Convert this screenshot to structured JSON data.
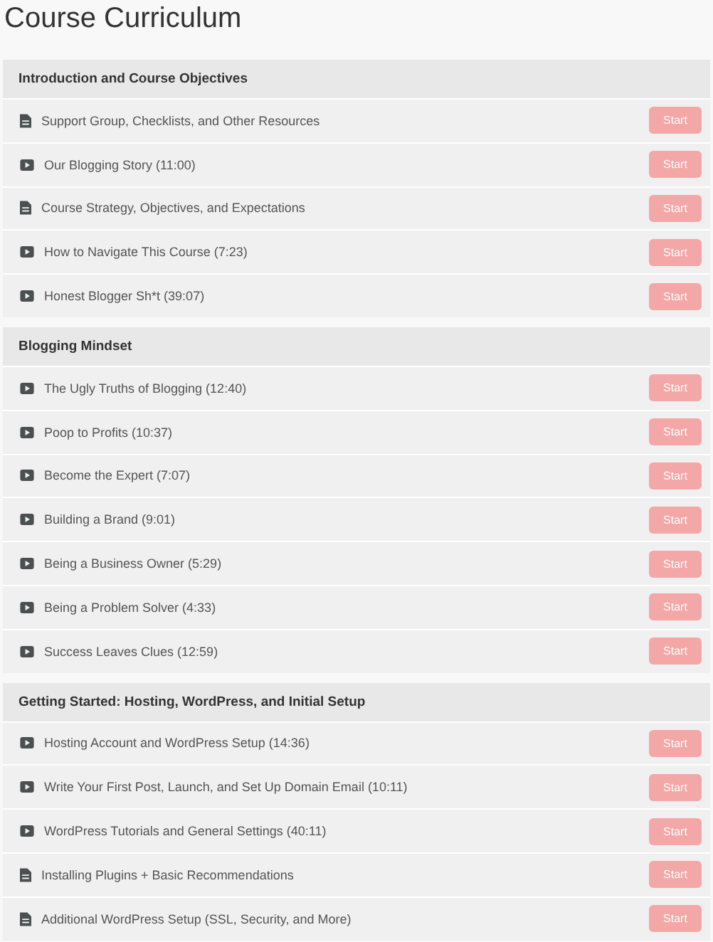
{
  "title": "Course Curriculum",
  "sections": [
    {
      "title": "Introduction and Course Objectives",
      "lessons": [
        {
          "kind": "document",
          "title": "Support Group, Checklists, and Other Resources",
          "button": "Start"
        },
        {
          "kind": "video",
          "title": "Our Blogging Story (11:00)",
          "button": "Start"
        },
        {
          "kind": "document",
          "title": "Course Strategy, Objectives, and Expectations",
          "button": "Start"
        },
        {
          "kind": "video",
          "title": "How to Navigate This Course (7:23)",
          "button": "Start"
        },
        {
          "kind": "video",
          "title": "Honest Blogger Sh*t (39:07)",
          "button": "Start"
        }
      ]
    },
    {
      "title": "Blogging Mindset",
      "lessons": [
        {
          "kind": "video",
          "title": "The Ugly Truths of Blogging (12:40)",
          "button": "Start"
        },
        {
          "kind": "video",
          "title": "Poop to Profits (10:37)",
          "button": "Start"
        },
        {
          "kind": "video",
          "title": "Become the Expert (7:07)",
          "button": "Start"
        },
        {
          "kind": "video",
          "title": "Building a Brand (9:01)",
          "button": "Start"
        },
        {
          "kind": "video",
          "title": "Being a Business Owner (5:29)",
          "button": "Start"
        },
        {
          "kind": "video",
          "title": "Being a Problem Solver (4:33)",
          "button": "Start"
        },
        {
          "kind": "video",
          "title": "Success Leaves Clues (12:59)",
          "button": "Start"
        }
      ]
    },
    {
      "title": "Getting Started: Hosting, WordPress, and Initial Setup",
      "lessons": [
        {
          "kind": "video",
          "title": "Hosting Account and WordPress Setup (14:36)",
          "button": "Start"
        },
        {
          "kind": "video",
          "title": "Write Your First Post, Launch, and Set Up Domain Email (10:11)",
          "button": "Start"
        },
        {
          "kind": "video",
          "title": "WordPress Tutorials and General Settings (40:11)",
          "button": "Start"
        },
        {
          "kind": "document",
          "title": "Installing Plugins + Basic Recommendations",
          "button": "Start"
        },
        {
          "kind": "document",
          "title": "Additional WordPress Setup (SSL, Security, and More)",
          "button": "Start"
        }
      ]
    }
  ]
}
